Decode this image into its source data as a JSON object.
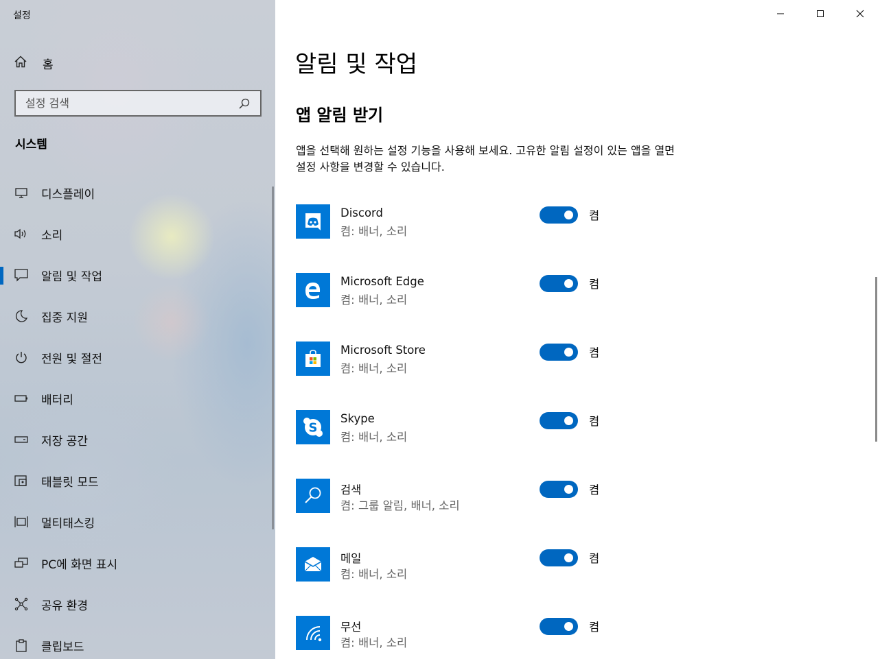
{
  "window": {
    "title": "설정"
  },
  "sidebar": {
    "home_label": "홈",
    "search_placeholder": "설정 검색",
    "section_title": "시스템",
    "items": [
      {
        "label": "디스플레이",
        "icon": "display-icon"
      },
      {
        "label": "소리",
        "icon": "speaker-icon"
      },
      {
        "label": "알림 및 작업",
        "icon": "notification-icon",
        "active": true
      },
      {
        "label": "집중 지원",
        "icon": "moon-icon"
      },
      {
        "label": "전원 및 절전",
        "icon": "power-icon"
      },
      {
        "label": "배터리",
        "icon": "battery-icon"
      },
      {
        "label": "저장 공간",
        "icon": "storage-icon"
      },
      {
        "label": "태블릿 모드",
        "icon": "tablet-icon"
      },
      {
        "label": "멀티태스킹",
        "icon": "multitasking-icon"
      },
      {
        "label": "PC에 화면 표시",
        "icon": "project-icon"
      },
      {
        "label": "공유 환경",
        "icon": "share-icon"
      },
      {
        "label": "클립보드",
        "icon": "clipboard-icon"
      }
    ]
  },
  "main": {
    "title": "알림 및 작업",
    "subtitle": "앱 알림 받기",
    "description": "앱을 선택해 원하는 설정 기능을 사용해 보세요. 고유한 알림 설정이 있는 앱을 열면 설정 사항을 변경할 수 있습니다.",
    "apps": [
      {
        "name": "Discord",
        "detail": "켬: 배너, 소리",
        "toggle_label": "켬",
        "on": true,
        "icon": "discord-icon"
      },
      {
        "name": "Microsoft Edge",
        "detail": "켬: 배너, 소리",
        "toggle_label": "켬",
        "on": true,
        "icon": "edge-icon"
      },
      {
        "name": "Microsoft Store",
        "detail": "켬: 배너, 소리",
        "toggle_label": "켬",
        "on": true,
        "icon": "store-icon"
      },
      {
        "name": "Skype",
        "detail": "켬: 배너, 소리",
        "toggle_label": "켬",
        "on": true,
        "icon": "skype-icon"
      },
      {
        "name": "검색",
        "detail": "켬: 그룹 알림, 배너, 소리",
        "toggle_label": "켬",
        "on": true,
        "icon": "search-app-icon"
      },
      {
        "name": "메일",
        "detail": "켬: 배너, 소리",
        "toggle_label": "켬",
        "on": true,
        "icon": "mail-icon"
      },
      {
        "name": "무선",
        "detail": "켬: 배너, 소리",
        "toggle_label": "켬",
        "on": true,
        "icon": "wireless-icon"
      }
    ]
  },
  "colors": {
    "accent": "#0067c0",
    "app_tile": "#0078d7"
  }
}
